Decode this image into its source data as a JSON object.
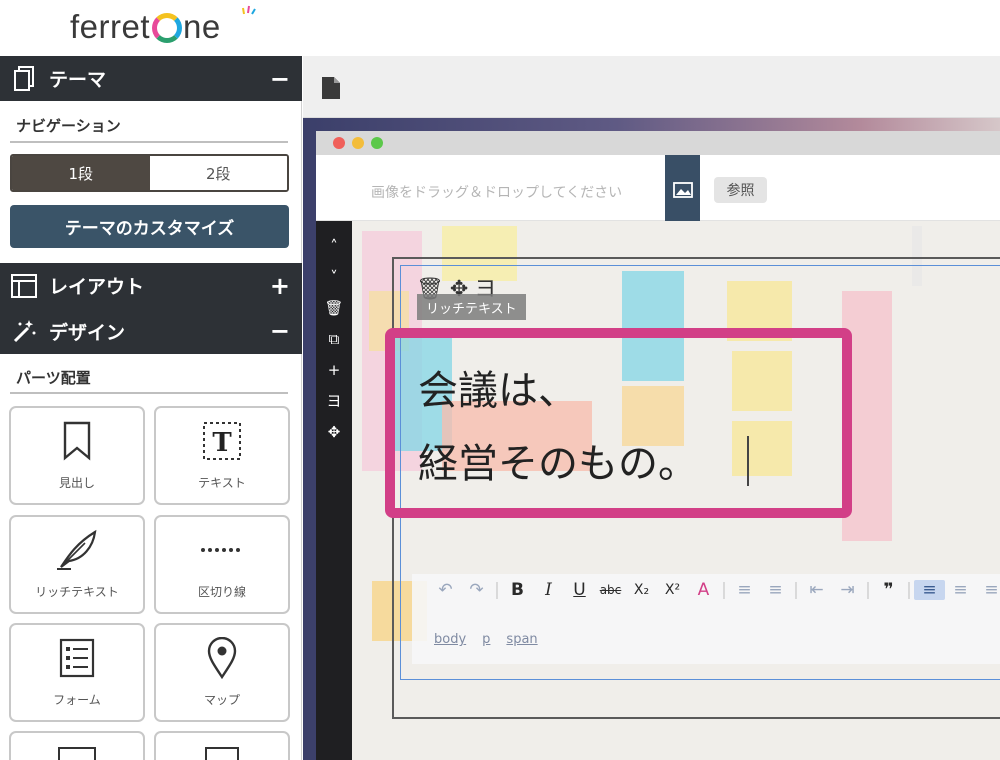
{
  "brand": {
    "name_prefix": "ferret",
    "name_suffix": "ne"
  },
  "sidebar": {
    "theme": {
      "title": "テーマ",
      "toggle": "−"
    },
    "navigation_label": "ナビゲーション",
    "segment": {
      "option_1": "1段",
      "option_2": "2段",
      "selected": "1段"
    },
    "customize_button": "テーマのカスタマイズ",
    "layout": {
      "title": "レイアウト",
      "toggle": "+"
    },
    "design": {
      "title": "デザイン",
      "toggle": "−"
    },
    "parts_label": "パーツ配置",
    "parts": [
      {
        "label": "見出し",
        "icon": "bookmark-icon"
      },
      {
        "label": "テキスト",
        "icon": "text-t-icon"
      },
      {
        "label": "リッチテキスト",
        "icon": "quill-icon"
      },
      {
        "label": "区切り線",
        "icon": "divider-icon"
      },
      {
        "label": "フォーム",
        "icon": "form-list-icon"
      },
      {
        "label": "マップ",
        "icon": "map-pin-icon"
      }
    ]
  },
  "editor": {
    "dropzone_text": "画像をドラッグ＆ドロップしてください",
    "browse_button": "参照",
    "left_tools": [
      "˄",
      "˅",
      "🗑",
      "⧉",
      "+",
      "ヨ",
      "✥"
    ],
    "richtext_tag": "リッチテキスト",
    "richtext_tools": "🗑✥ヨ",
    "content_line_1": "会議は、",
    "content_line_2": "経営そのもの。",
    "format_buttons": [
      "↶",
      "↷",
      "B",
      "I",
      "U",
      "abc",
      "X₂",
      "X²",
      "A",
      "≡",
      "≡",
      "⇤",
      "⇥",
      "❞",
      "≡",
      "≡",
      "≡"
    ],
    "path": [
      "body",
      "p",
      "span"
    ]
  },
  "colors": {
    "sidebar_header": "#2d3136",
    "accent_button": "#3a5468",
    "highlight": "#d23f87"
  }
}
